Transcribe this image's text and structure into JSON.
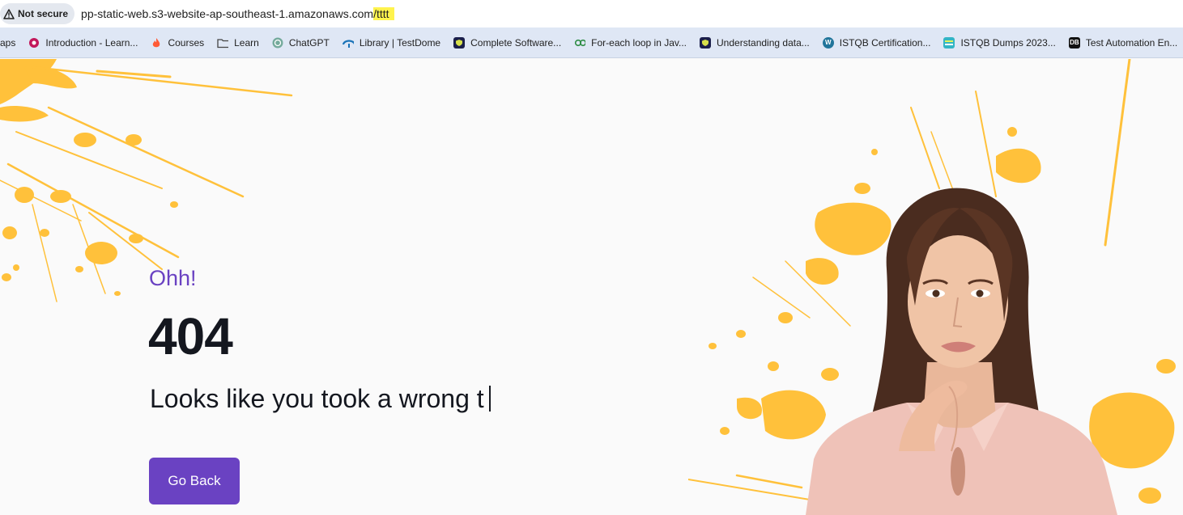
{
  "browser": {
    "security_label": "Not secure",
    "url_host": "pp-static-web.s3-website-ap-southeast-1.amazonaws.com",
    "url_path": "/tttt"
  },
  "bookmarks": [
    {
      "label": "aps",
      "icon": "apps-icon",
      "color": ""
    },
    {
      "label": "Introduction - Learn...",
      "icon": "learn-icon",
      "color": "#c2185b"
    },
    {
      "label": "Courses",
      "icon": "flame-icon",
      "color": "#ff5a36"
    },
    {
      "label": "Learn",
      "icon": "folder-icon",
      "color": ""
    },
    {
      "label": "ChatGPT",
      "icon": "chatgpt-icon",
      "color": "#74aa9c"
    },
    {
      "label": "Library | TestDome",
      "icon": "testdome-icon",
      "color": "#1a73b8"
    },
    {
      "label": "Complete Software...",
      "icon": "shield-icon",
      "color": "#1b1f4b"
    },
    {
      "label": "For-each loop in Jav...",
      "icon": "gfg-icon",
      "color": "#2f8d46"
    },
    {
      "label": "Understanding data...",
      "icon": "shield-icon",
      "color": "#1b1f4b"
    },
    {
      "label": "ISTQB Certification...",
      "icon": "wordpress-icon",
      "color": "#21759b"
    },
    {
      "label": "ISTQB Dumps 2023...",
      "icon": "dumps-icon",
      "color": "#33b5c4"
    },
    {
      "label": "Test Automation En...",
      "icon": "db-icon",
      "color": "#111111"
    }
  ],
  "page": {
    "exclaim": "Ohh!",
    "code": "404",
    "message": "Looks like you took a wrong t",
    "go_back": "Go Back"
  },
  "colors": {
    "accent": "#6a42c2",
    "splash": "#ffc13b",
    "text": "#14171f"
  }
}
